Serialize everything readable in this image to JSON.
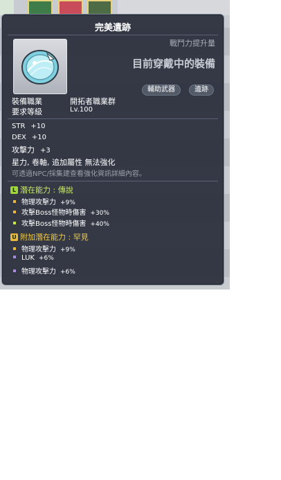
{
  "item": {
    "name": "完美遺跡",
    "power_label": "戰鬥力提升量",
    "equipped_label": "目前穿戴中的裝備",
    "tags": [
      "輔助武器",
      "遺跡"
    ],
    "job_label": "裝備職業",
    "job_value": "開拓者職業群",
    "level_label": "要求等級",
    "level_value": "Lv.100"
  },
  "stats": [
    {
      "name": "STR",
      "value": "+10"
    },
    {
      "name": "DEX",
      "value": "+10"
    },
    {
      "name": "攻擊力",
      "value": "+3"
    }
  ],
  "enhance_line": "星力, 卷軸, 追加屬性 無法強化",
  "hint_line": "可透過NPC/採集建查看強化資訊詳細內容。",
  "potential": {
    "badge": "L",
    "title": "潛在能力 : 傳說",
    "lines": [
      {
        "text": "物理攻擊力",
        "value": "+9%"
      },
      {
        "text": "攻擊Boss怪物時傷害",
        "value": "+30%"
      },
      {
        "text": "攻擊Boss怪物時傷害",
        "value": "+40%"
      }
    ]
  },
  "bonus_potential": {
    "badge": "U",
    "title": "附加潛在能力 : 罕見",
    "lines": [
      {
        "text": "物理攻擊力",
        "value": "+9%"
      },
      {
        "text": "LUK",
        "value": "+6%"
      },
      {
        "text": "物理攻擊力",
        "value": "+6%"
      }
    ]
  },
  "colors": {
    "legendary": "#cdea6a",
    "unique": "#f0c94a",
    "panel": "#2a303c"
  },
  "icons": [
    "relic-orb-icon"
  ]
}
